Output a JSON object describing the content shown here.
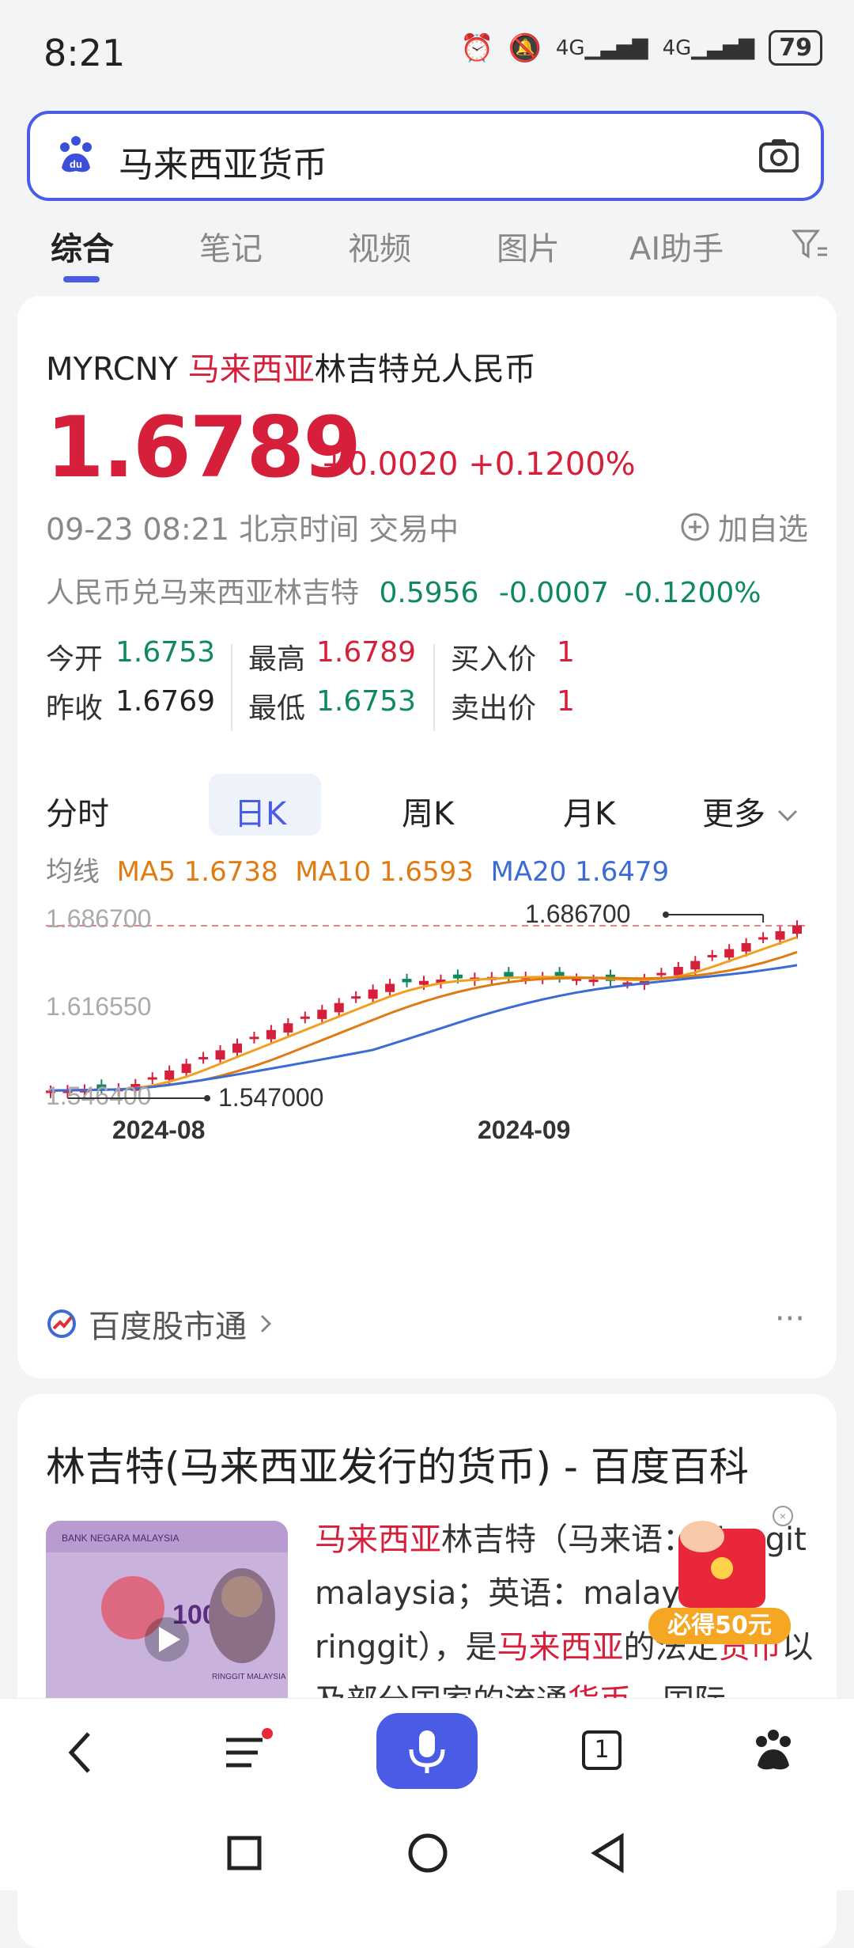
{
  "status": {
    "time": "8:21",
    "battery": "79",
    "net1": "4G",
    "net2": "4G"
  },
  "search": {
    "query": "马来西亚货币"
  },
  "tabs": [
    "综合",
    "笔记",
    "视频",
    "图片",
    "AI助手"
  ],
  "quote": {
    "symbol": "MYRCNY",
    "name_highlight": "马来西亚",
    "name_rest": "林吉特兑人民币",
    "price": "1.6789",
    "change": "+0.0020",
    "change_pct": "+0.1200%",
    "meta": "09-23 08:21 北京时间 交易中",
    "add_fav": "加自选",
    "reverse_label": "人民币兑马来西亚林吉特",
    "reverse_price": "0.5956",
    "reverse_change": "-0.0007",
    "reverse_pct": "-0.1200%"
  },
  "stats": {
    "open_label": "今开",
    "open": "1.6753",
    "prev_label": "昨收",
    "prev": "1.6769",
    "high_label": "最高",
    "high": "1.6789",
    "low_label": "最低",
    "low": "1.6753",
    "bid_label": "买入价",
    "bid": "1",
    "ask_label": "卖出价",
    "ask": "1"
  },
  "k_tabs": [
    "分时",
    "日K",
    "周K",
    "月K",
    "更多"
  ],
  "ma": {
    "label": "均线",
    "ma5": "MA5 1.6738",
    "ma10": "MA10 1.6593",
    "ma20": "MA20 1.6479"
  },
  "chart_data": {
    "type": "candlestick",
    "y_ticks": [
      "1.686700",
      "1.616550",
      "1.546400"
    ],
    "x_ticks": [
      "2024-08",
      "2024-09"
    ],
    "high_annotation": "1.686700",
    "low_annotation": "1.547000",
    "ylim": [
      1.5464,
      1.6867
    ]
  },
  "brand": {
    "label": "百度股市通"
  },
  "card2": {
    "title": "林吉特(马来西亚发行的货币) - 百度百科",
    "t1": "马来西亚",
    "t2": "林吉特（马来语：Ringgit malaysia；英语：malaysia ringgit），是",
    "t3": "马来西亚",
    "t4": "的法定",
    "t5": "货币",
    "t6": "以及部分国家的流通",
    "t7": "货币",
    "t8": "，国际",
    "note_text": "100",
    "note_bank": "BANK NEGARA MALAYSIA",
    "note_serial": "RINGGIT MALAYSIA"
  },
  "promo": {
    "label": "必得50元"
  },
  "nav": {
    "tab_count": "1"
  },
  "colors": {
    "accent": "#4a5be5",
    "up": "#d61f3a",
    "down": "#0f8a5f",
    "ma5": "#e07b12",
    "ma20": "#3c6bd6"
  }
}
